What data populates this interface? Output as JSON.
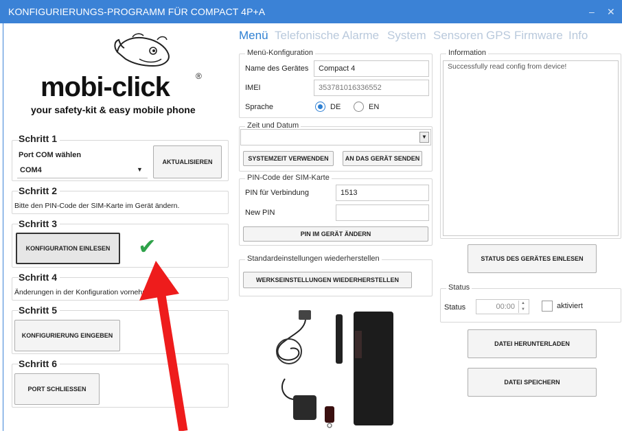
{
  "window": {
    "title": "KONFIGURIERUNGS-PROGRAMM FÜR COMPACT 4P+A",
    "minimize_glyph": "–",
    "close_glyph": "✕"
  },
  "logo": {
    "brand": "mobi-click",
    "registered": "®",
    "tagline": "your safety-kit & easy mobile phone"
  },
  "tabs": [
    {
      "label": "Menü",
      "active": true
    },
    {
      "label": "Telefonische Alarme",
      "active": false
    },
    {
      "label": "System",
      "active": false
    },
    {
      "label": "Sensoren",
      "active": false
    },
    {
      "label": "GPS",
      "active": false
    },
    {
      "label": "Firmware",
      "active": false
    },
    {
      "label": "Info",
      "active": false
    }
  ],
  "steps": {
    "s1": {
      "title": "Schritt 1",
      "port_label": "Port COM wählen",
      "port_value": "COM4",
      "refresh_button": "AKTUALISIEREN"
    },
    "s2": {
      "title": "Schritt 2",
      "text": "Bitte den PIN-Code der SIM-Karte im Gerät ändern."
    },
    "s3": {
      "title": "Schritt 3",
      "button": "KONFIGURATION EINLESEN",
      "check_glyph": "✔"
    },
    "s4": {
      "title": "Schritt 4",
      "text": "Änderungen in der Konfiguration vornehmen"
    },
    "s5": {
      "title": "Schritt 5",
      "button": "KONFIGURIERUNG EINGEBEN"
    },
    "s6": {
      "title": "Schritt 6",
      "button": "PORT SCHLIEßEN"
    }
  },
  "menu_config": {
    "title": "Menü-Konfiguration",
    "name_label": "Name des Gerätes",
    "name_value": "Compact 4",
    "imei_label": "IMEI",
    "imei_value": "353781016336552",
    "language_label": "Sprache",
    "lang_de": "DE",
    "lang_en": "EN",
    "selected_lang": "DE"
  },
  "datetime": {
    "title": "Zeit und Datum",
    "value": "",
    "system_time_button": "SYSTEMZEIT VERWENDEN",
    "send_button": "AN DAS GERÄT SENDEN"
  },
  "pin": {
    "title": "PIN-Code der SIM-Karte",
    "conn_label": "PIN für Verbindung",
    "conn_value": "1513",
    "new_label": "New PIN",
    "new_value": "",
    "change_button": "PIN IM GERÄT ÄNDERN"
  },
  "defaults": {
    "title": "Standardeinstellungen wiederherstellen",
    "button": "WERKSEINSTELLUNGEN WIEDERHERSTELLEN"
  },
  "information": {
    "title": "Information",
    "message": "Successfully read config from device!",
    "status_button": "STATUS DES GERÄTES EINLESEN"
  },
  "status": {
    "title": "Status",
    "label": "Status",
    "time_value": "00:00",
    "checkbox_label": "aktiviert",
    "checked": false
  },
  "files": {
    "download_button": "DATEI HERUNTERLADEN",
    "save_button": "DATEI SPEICHERN"
  },
  "colors": {
    "titlebar": "#3b82d6",
    "tab_active": "#2d7fd2",
    "tab_inactive": "#b9c9dc",
    "check": "#2fa24a",
    "arrow": "#ee1c1c"
  }
}
